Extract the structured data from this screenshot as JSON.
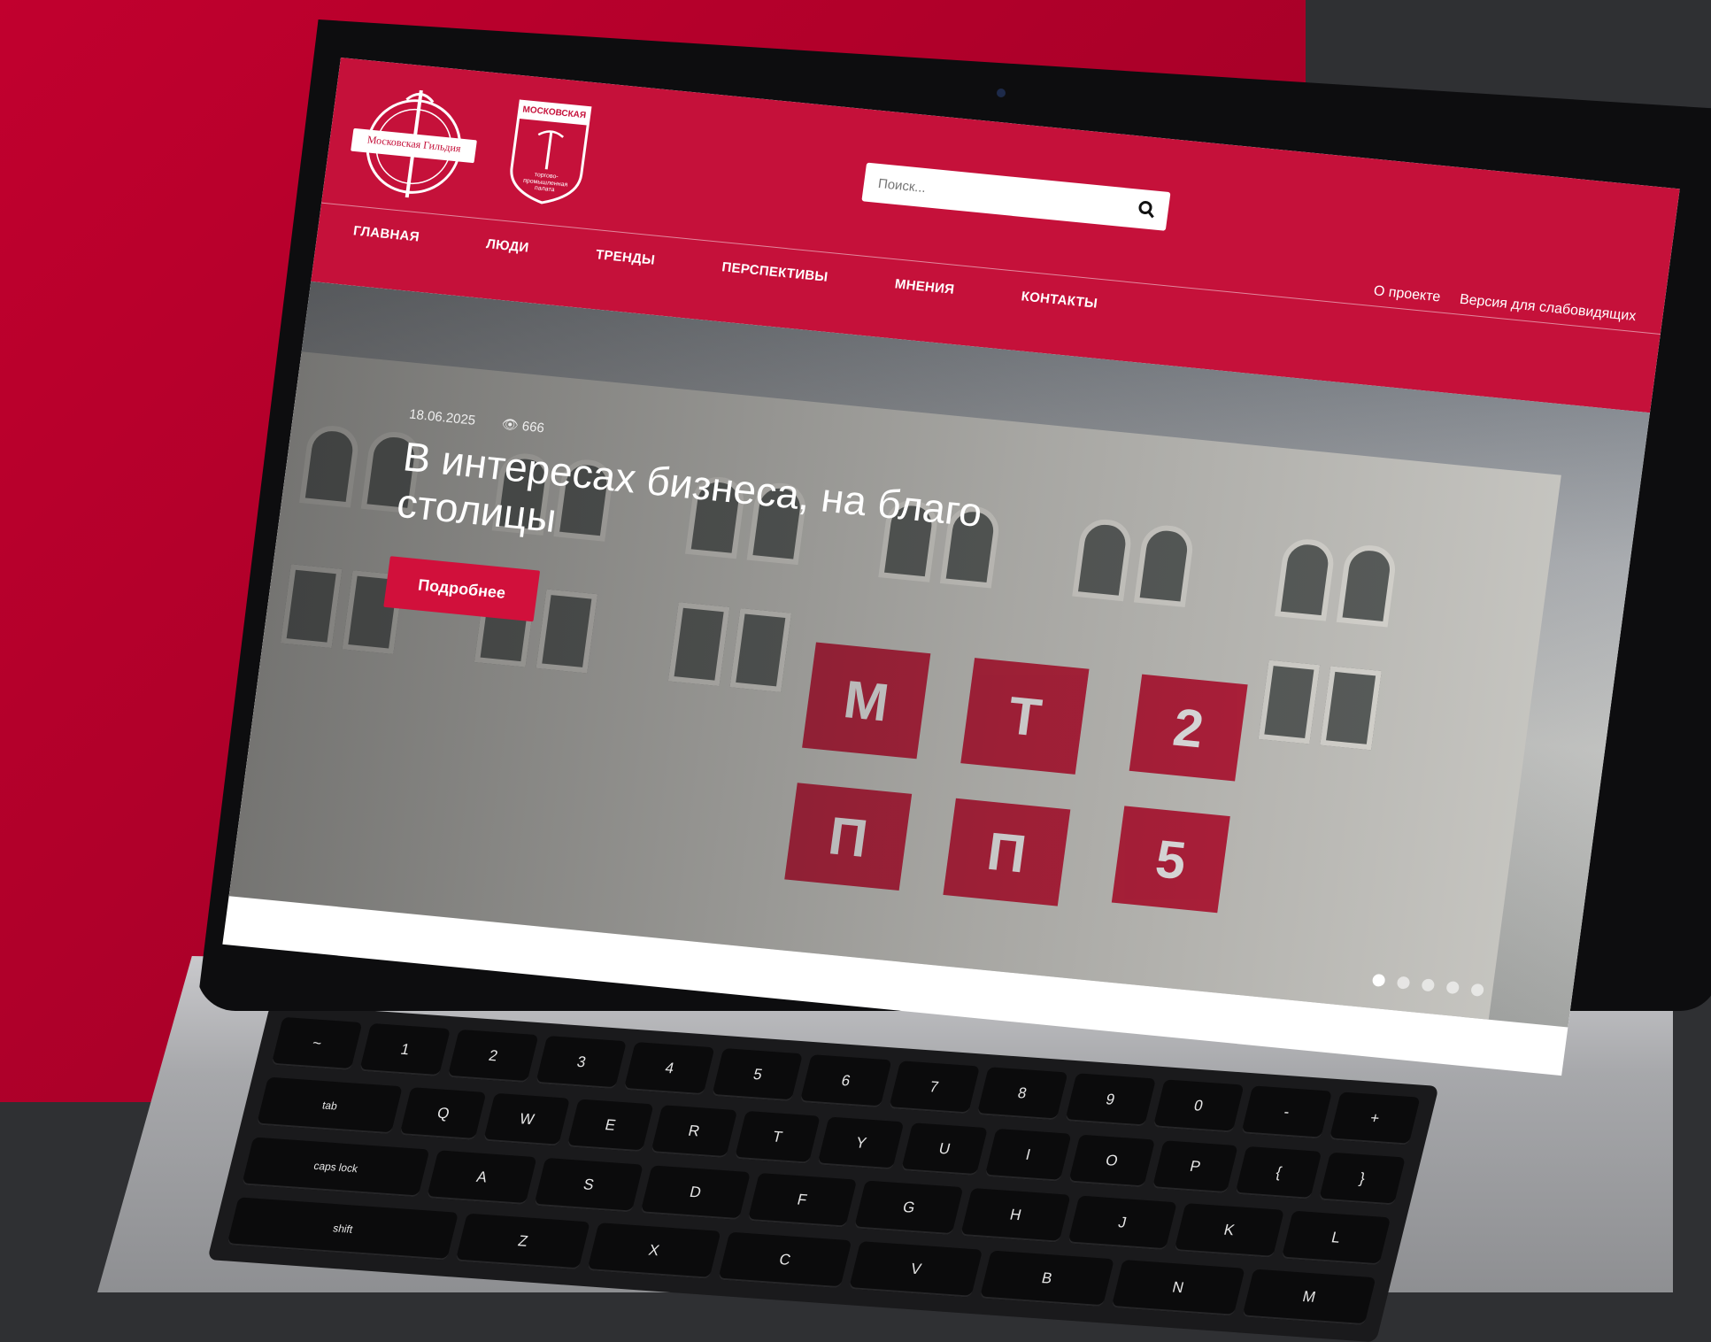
{
  "header": {
    "logo1_text": "Московская Гильдия",
    "logo2_title": "МОСКОВСКАЯ",
    "logo2_sub": "торгово-промышленная палата",
    "search_placeholder": "Поиск...",
    "links": [
      "О проекте",
      "Версия для слабовидящих"
    ]
  },
  "nav": [
    "ГЛАВНАЯ",
    "ЛЮДИ",
    "ТРЕНДЫ",
    "ПЕРСПЕКТИВЫ",
    "МНЕНИЯ",
    "КОНТАКТЫ"
  ],
  "hero": {
    "date": "18.06.2025",
    "views": "666",
    "title": "В интересах бизнеса, на благо столицы",
    "button": "Подробнее",
    "facade_letters": [
      "М",
      "Т",
      "2",
      "П",
      "П",
      "5"
    ],
    "slides": 5,
    "active_slide": 1
  },
  "keyboard": {
    "row1": [
      "~",
      "1",
      "2",
      "3",
      "4",
      "5",
      "6",
      "7",
      "8",
      "9",
      "0",
      "-",
      "+"
    ],
    "row2": [
      "tab",
      "Q",
      "W",
      "E",
      "R",
      "T",
      "Y",
      "U",
      "I",
      "O",
      "P",
      "{",
      "}"
    ],
    "row3": [
      "caps lock",
      "A",
      "S",
      "D",
      "F",
      "G",
      "H",
      "J",
      "K",
      "L"
    ],
    "row4": [
      "shift",
      "Z",
      "X",
      "C",
      "V",
      "B",
      "N",
      "M"
    ]
  },
  "colors": {
    "brand_red": "#c5113a",
    "background_dark": "#2f3033"
  }
}
